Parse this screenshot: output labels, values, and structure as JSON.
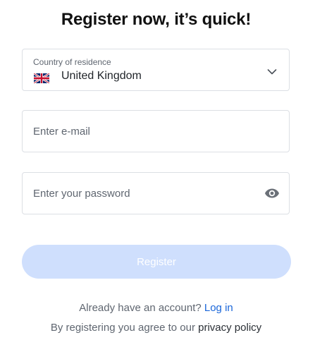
{
  "title": "Register now, it’s quick!",
  "country": {
    "label": "Country of residence",
    "value": "United Kingdom",
    "flag_icon": "uk-flag-icon",
    "chevron_icon": "chevron-down-icon"
  },
  "email": {
    "placeholder": "Enter e-mail",
    "value": ""
  },
  "password": {
    "placeholder": "Enter your password",
    "value": "",
    "toggle_icon": "eye-icon"
  },
  "register_button": {
    "label": "Register",
    "state": "disabled"
  },
  "login_prompt": {
    "text": "Already have an account?",
    "link": "Log in"
  },
  "policy": {
    "text": "By registering you agree to our",
    "link": "privacy policy"
  },
  "colors": {
    "button_bg": "#cfdffd",
    "link": "#1a66d9",
    "border": "#dcdfe4"
  }
}
